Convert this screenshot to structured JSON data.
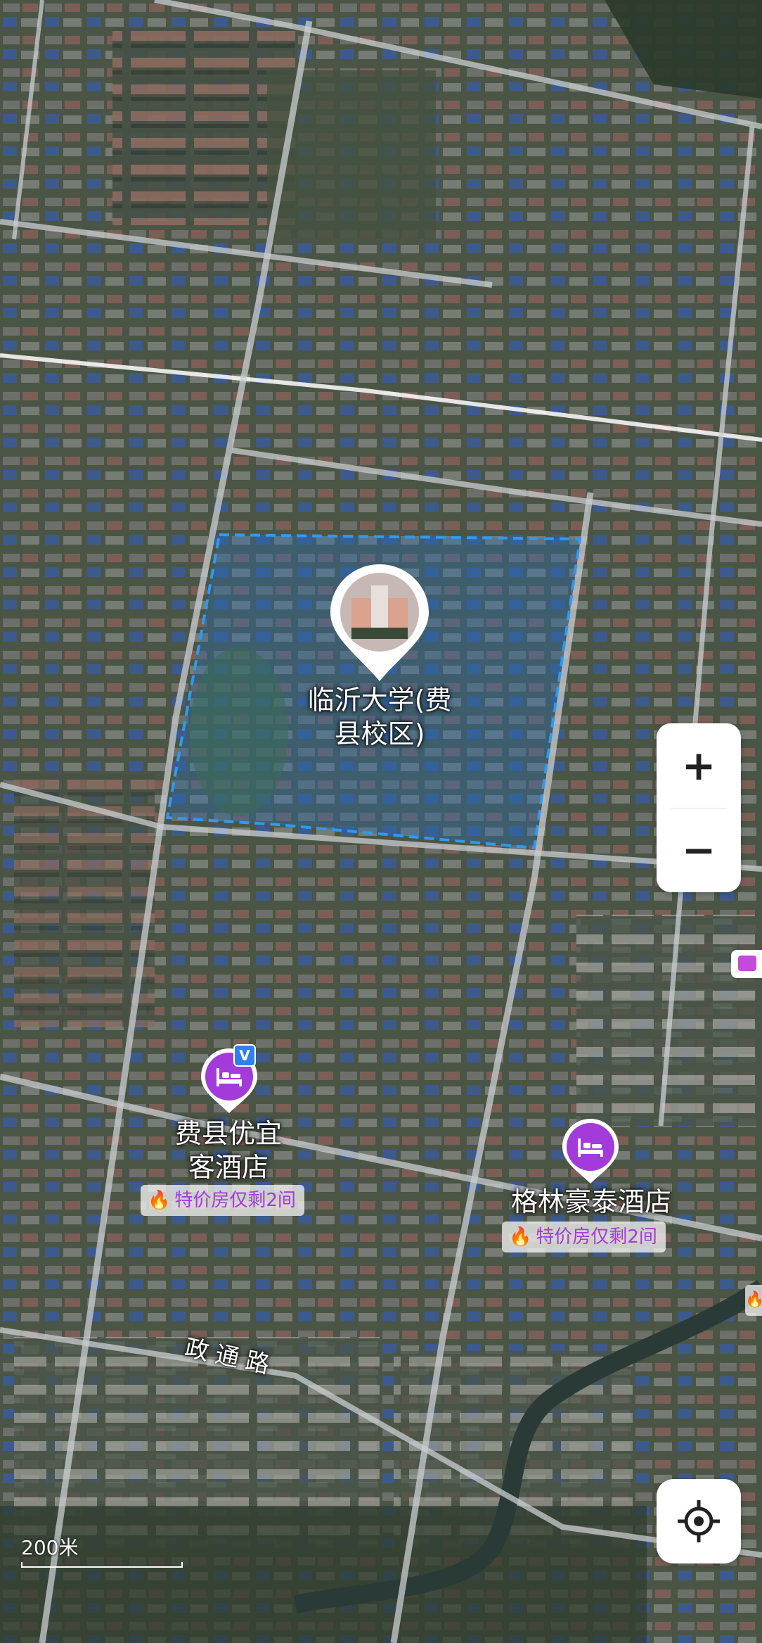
{
  "poi": {
    "university": {
      "name_line1": "临沂大学(费",
      "name_line2": "县校区)"
    },
    "hotel1": {
      "name_line1": "费县优宜",
      "name_line2": "客酒店",
      "promo": "特价房仅剩2间",
      "verified_badge": "V"
    },
    "hotel2": {
      "name": "格林豪泰酒店",
      "promo": "特价房仅剩2间"
    }
  },
  "road": {
    "name": "政通路"
  },
  "controls": {
    "zoom_in": "+",
    "zoom_out": "−"
  },
  "scale": {
    "label": "200米"
  },
  "colors": {
    "poi_purple": "#a23bd9",
    "campus_outline": "#2f9af0",
    "promo_text": "#a23bd9",
    "flame": "#f05a28"
  },
  "icons": {
    "hotel": "bed-icon",
    "locate": "crosshair-icon",
    "promo": "flame-icon"
  }
}
